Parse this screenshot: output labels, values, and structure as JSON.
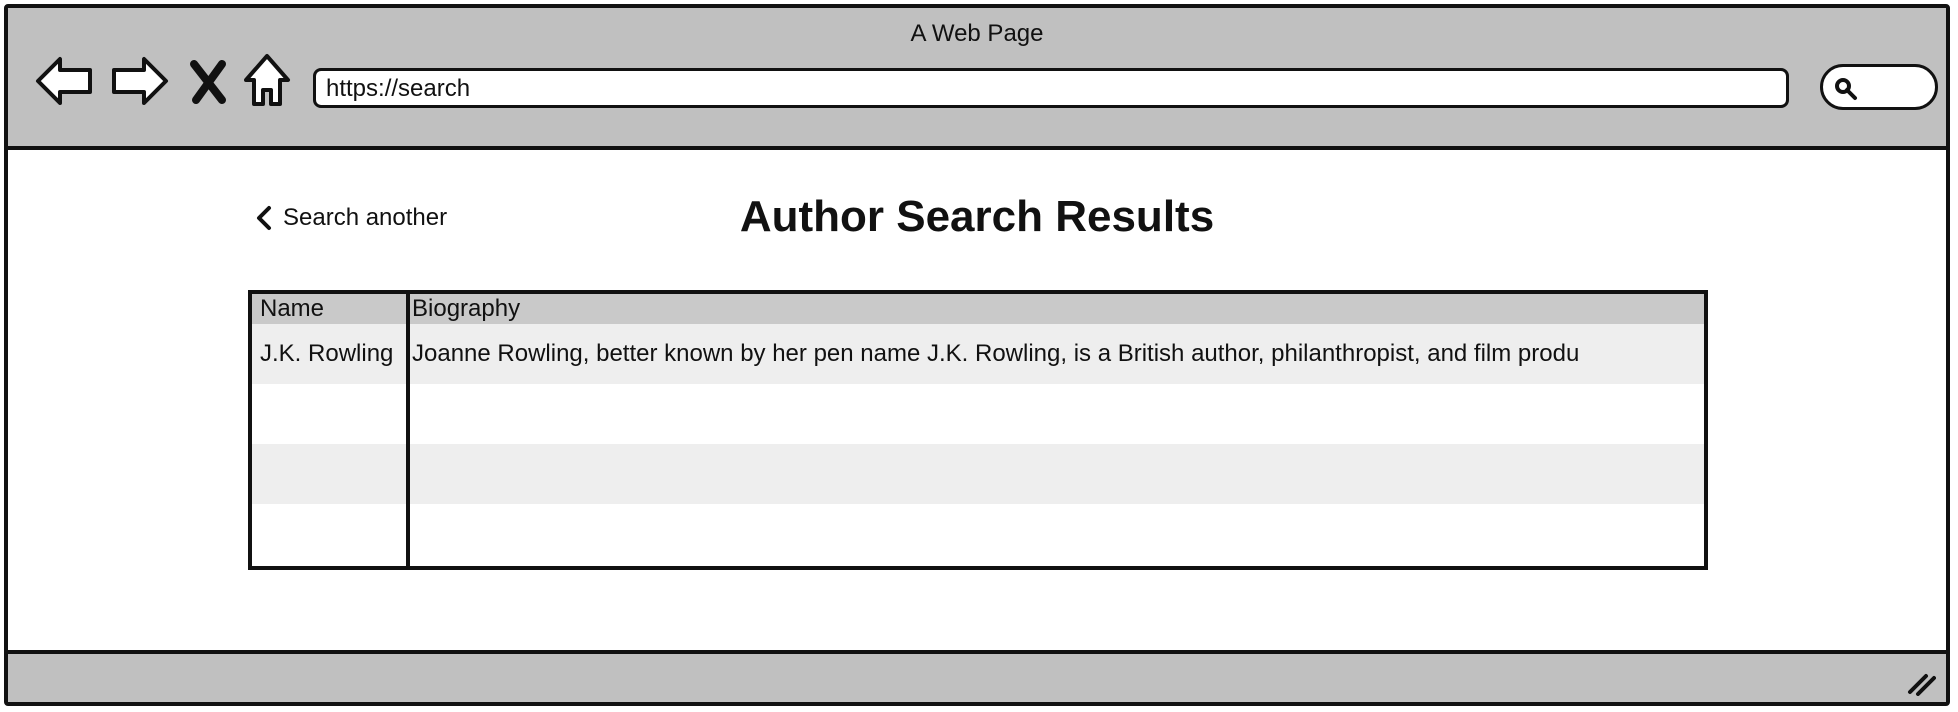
{
  "window": {
    "title": "A Web Page"
  },
  "toolbar": {
    "back_icon": "back-arrow-icon",
    "forward_icon": "forward-arrow-icon",
    "stop_icon": "close-icon",
    "home_icon": "home-icon",
    "address": "https://search",
    "search_icon": "search-icon"
  },
  "page": {
    "back_link_label": "Search another",
    "title": "Author Search Results"
  },
  "table": {
    "columns": [
      "Name",
      "Biography"
    ],
    "rows": [
      {
        "name": "J.K. Rowling",
        "biography": "Joanne Rowling, better known by her pen name J.K. Rowling, is a British author, philanthropist, and film produ"
      },
      {
        "name": "",
        "biography": ""
      },
      {
        "name": "",
        "biography": ""
      },
      {
        "name": "",
        "biography": ""
      }
    ]
  },
  "colors": {
    "chrome": "#c0c0c0",
    "header_row": "#c9c9c9",
    "alt_row": "#eeeeee",
    "border": "#111111"
  }
}
